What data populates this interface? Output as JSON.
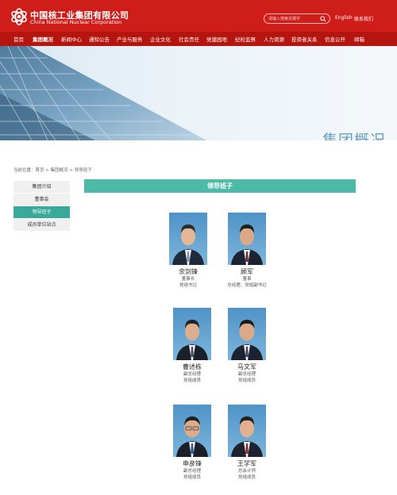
{
  "header": {
    "logo_cn": "中国核工业集团有限公司",
    "logo_en": "China National Nuclear Corporation",
    "search_placeholder": "请输入搜索关键字",
    "english_link": "English",
    "contact_link": "联系我们"
  },
  "nav": {
    "items": [
      {
        "label": "首页"
      },
      {
        "label": "集团概况"
      },
      {
        "label": "新闻中心"
      },
      {
        "label": "通知公告"
      },
      {
        "label": "产业与服务"
      },
      {
        "label": "企业文化"
      },
      {
        "label": "社会责任"
      },
      {
        "label": "党建园地"
      },
      {
        "label": "纪检监察"
      },
      {
        "label": "人力资源"
      },
      {
        "label": "投资者关系"
      },
      {
        "label": "信息公开"
      },
      {
        "label": "邮箱"
      }
    ]
  },
  "banner": {
    "title": "集团概况"
  },
  "breadcrumb": {
    "prefix": "当前位置：",
    "home": "首页",
    "sep1": " > ",
    "parent": "集团概况",
    "sep2": " > ",
    "current": "领导班子"
  },
  "sidebar": {
    "items": [
      {
        "label": "集团介绍"
      },
      {
        "label": "董事会"
      },
      {
        "label": "领导班子"
      },
      {
        "label": "成员单位站点"
      }
    ]
  },
  "main": {
    "section_title": "领导班子",
    "leaders": [
      {
        "name": "余剑锋",
        "title1": "董事长",
        "title2": "党组书记"
      },
      {
        "name": "顾军",
        "title1": "董事",
        "title2": "总经理、党组副书记"
      },
      {
        "name": "曹述栋",
        "title1": "副总经理",
        "title2": "党组成员"
      },
      {
        "name": "马文军",
        "title1": "副总经理",
        "title2": "党组成员"
      },
      {
        "name": "申彦锋",
        "title1": "副总经理",
        "title2": "党组成员"
      },
      {
        "name": "王学军",
        "title1": "总会计师",
        "title2": "党组成员"
      }
    ]
  },
  "colors": {
    "header_red": "#cf1d1a",
    "nav_red": "#b5140f",
    "teal": "#4dbaa8",
    "teal_active": "#39a99b"
  }
}
